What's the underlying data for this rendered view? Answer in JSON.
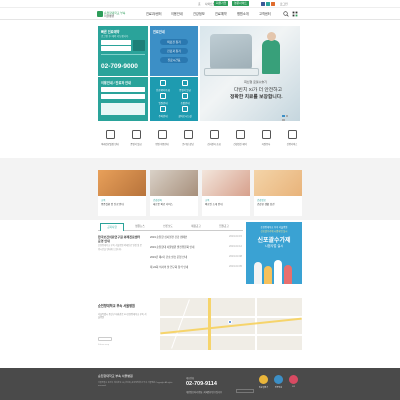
{
  "util": {
    "links": [
      "홈",
      "사이트맵",
      "로그인"
    ],
    "buttons": [
      "회원가입",
      "영문사이트"
    ],
    "colors": {
      "green": "#2e9d5a",
      "blue": "#3c8fc6"
    }
  },
  "header": {
    "logo_line1": "순천향대학교 부속",
    "logo_line2": "서울병원",
    "nav": [
      "진료과/센터",
      "이용안내",
      "건강정보",
      "진료예약",
      "병원소개",
      "고객센터"
    ]
  },
  "quick": {
    "reserve_title": "빠른 진료예약",
    "reserve_sub": "로그인 후 예약 가능합니다",
    "phone": "02-709-9000",
    "guide_title": "진료안내",
    "guide_pills": [
      "의료진 찾기",
      "진료과 찾기",
      "진료시간표"
    ],
    "box3_title": "이용안내 / 진료과 안내",
    "box4_items": [
      "진료예약/조회",
      "증명서 발급",
      "입원안내",
      "층별안내",
      "주차안내",
      "찾아오시는길"
    ]
  },
  "hero": {
    "caption1": "최신형 로봇수술기",
    "caption2": "다빈치 Xi가 더 안전하고",
    "caption3": "정확한 치료를 보장합니다."
  },
  "iconrow": [
    "외래진료일정 안내",
    "증명서 발급",
    "병원 이용안내",
    "온라인 상담",
    "검사결과 조회",
    "건강검진 예약",
    "자원봉사",
    "간병서비스"
  ],
  "cards": [
    {
      "tag": "교육",
      "title": "중증질환 암 진료 안내"
    },
    {
      "tag": "건강강좌",
      "title": "새로운 의료 서비스"
    },
    {
      "tag": "교육",
      "title": "의료진 소개 안내"
    },
    {
      "tag": "건강정보",
      "title": "건강한 생활 습관"
    },
    {
      "tag": "이벤트",
      "title": "병원 소식 및 행사"
    }
  ],
  "notice": {
    "tabs": [
      "공지사항",
      "병원뉴스",
      "언론보도",
      "채용공고",
      "입찰공고"
    ],
    "headline": "한국보건의료연구원 외래진료센터 운영 안내",
    "excerpt": "순천향대학교 부속 서울병원 외래진료 일정 및 운영시간을 안내해 드립니다.",
    "items": [
      {
        "title": "2019 순천향 심뇌혈관 건강 캠페인",
        "date": "2019.03.15"
      },
      {
        "title": "2019 순천향대 서울병원 발전위원회 안내",
        "date": "2019.03.12"
      },
      {
        "title": "2019년 제2기 간호 실습 운영 안내",
        "date": "2019.03.08"
      },
      {
        "title": "제 24회 의사의 날 연구회 참석 안내",
        "date": "2019.03.05"
      }
    ]
  },
  "banner": {
    "line1": "순천향대학교 부속 서울병원",
    "line2": "신포괄수가제 시범사업 실시",
    "line3": "신포괄수가제",
    "line4": "시범사업 실시"
  },
  "map": {
    "title": "순천향대학교 부속 서울병원",
    "address": "서울특별시 용산구 대사관로 59 순천향대학교 부속 서울병원",
    "credit": "Kakao map"
  },
  "footer": {
    "logo": "순천향대학교 부속 서울병원",
    "tel_label": "대표전화",
    "tel": "02-709-9114",
    "address": "서울특별시 용산구 대사관로 59 (한남동) 순천향대학교 부속 서울병원 Copyright All rights reserved.",
    "links": "개인정보처리방침 | 이메일무단수집거부",
    "circles": [
      {
        "label": "의료질평가",
        "color": "#e9b53a"
      },
      {
        "label": "인증병원",
        "color": "#3c8fc6"
      },
      {
        "label": "JCI",
        "color": "#d84a62"
      }
    ]
  }
}
